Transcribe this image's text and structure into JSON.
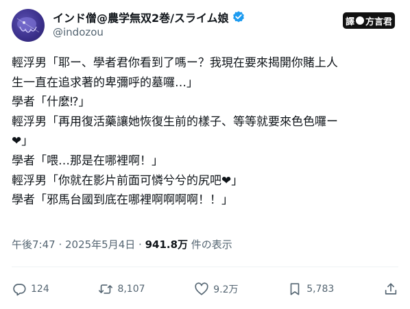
{
  "author": {
    "display_name": "インド僧@農学無双2巻/スライム娘",
    "handle": "@indozou",
    "verified_icon": "verified-badge-icon",
    "avatar": "avatar"
  },
  "app_badge": {
    "left": "譯",
    "right": "方言君"
  },
  "tweet": {
    "lines": [
      "輕浮男「耶ー、學者君你看到了嗎ー？我現在要來揭開你賭上人",
      "生一直在追求著的卑彌呼的墓囉…」",
      "學者「什麼⁉」",
      "輕浮男「再用復活藥讓她恢復生前的樣子、等等就要來色色囉ー",
      "❤」",
      "學者「喂…那是在哪裡啊！」",
      "輕浮男「你就在影片前面可憐兮兮的尻吧❤」",
      "學者「邪馬台國到底在哪裡啊啊啊啊！！」"
    ]
  },
  "meta": {
    "time": "午後7:47",
    "sep1": " · ",
    "date": "2025年5月4日",
    "sep2": " · ",
    "views": "941.8万",
    "views_suffix": " 件の表示"
  },
  "actions": {
    "reply_count": "124",
    "retweet_count": "8,107",
    "like_count": "9.2万",
    "bookmark_count": "5,783"
  },
  "colors": {
    "text": "#0f1419",
    "muted": "#536471",
    "verified": "#1d9bf0"
  }
}
